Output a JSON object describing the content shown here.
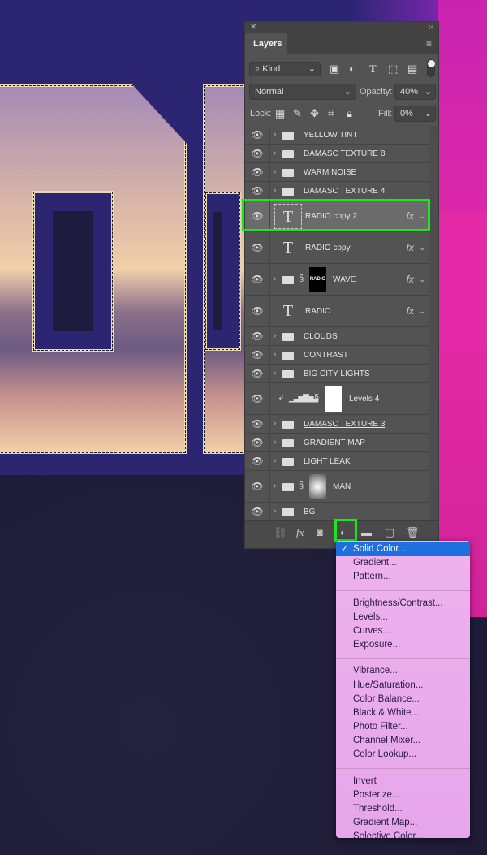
{
  "panel": {
    "title": "Layers",
    "filter": "Kind",
    "blend_mode": "Normal",
    "opacity_label": "Opacity:",
    "opacity": "40%",
    "lock_label": "Lock:",
    "fill_label": "Fill:",
    "fill": "0%"
  },
  "layers": [
    {
      "name": "YELLOW TINT",
      "type": "group"
    },
    {
      "name": "DAMASC TEXTURE 8",
      "type": "group"
    },
    {
      "name": "WARM NOISE",
      "type": "group"
    },
    {
      "name": "DAMASC TEXTURE 4",
      "type": "group"
    },
    {
      "name": "RADIO copy 2",
      "type": "text",
      "fx": "fx",
      "selected": true
    },
    {
      "name": "RADIO copy",
      "type": "text",
      "fx": "fx"
    },
    {
      "name": "WAVE",
      "type": "group-mask",
      "fx": "fx",
      "thumb_text": "RADIO"
    },
    {
      "name": "RADIO",
      "type": "text",
      "fx": "fx"
    },
    {
      "name": "CLOUDS",
      "type": "group"
    },
    {
      "name": "CONTRAST",
      "type": "group"
    },
    {
      "name": "BIG CITY LIGHTS",
      "type": "group"
    },
    {
      "name": "Levels 4",
      "type": "adjustment"
    },
    {
      "name": "DAMASC TEXTURE 3",
      "type": "group"
    },
    {
      "name": "GRADIENT MAP",
      "type": "group"
    },
    {
      "name": "LIGHT LEAK",
      "type": "group"
    },
    {
      "name": "MAN",
      "type": "group-mask"
    },
    {
      "name": "BG",
      "type": "group"
    }
  ],
  "menu": {
    "groups": [
      [
        "Solid Color...",
        "Gradient...",
        "Pattern..."
      ],
      [
        "Brightness/Contrast...",
        "Levels...",
        "Curves...",
        "Exposure..."
      ],
      [
        "Vibrance...",
        "Hue/Saturation...",
        "Color Balance...",
        "Black & White...",
        "Photo Filter...",
        "Channel Mixer...",
        "Color Lookup..."
      ],
      [
        "Invert",
        "Posterize...",
        "Threshold...",
        "Gradient Map...",
        "Selective Color..."
      ]
    ],
    "checked": "Solid Color...",
    "check_mark": "✓"
  },
  "colors": {
    "highlight": "#1ee61e",
    "menu_selected": "#1e6fe0",
    "panel": "#535353"
  }
}
